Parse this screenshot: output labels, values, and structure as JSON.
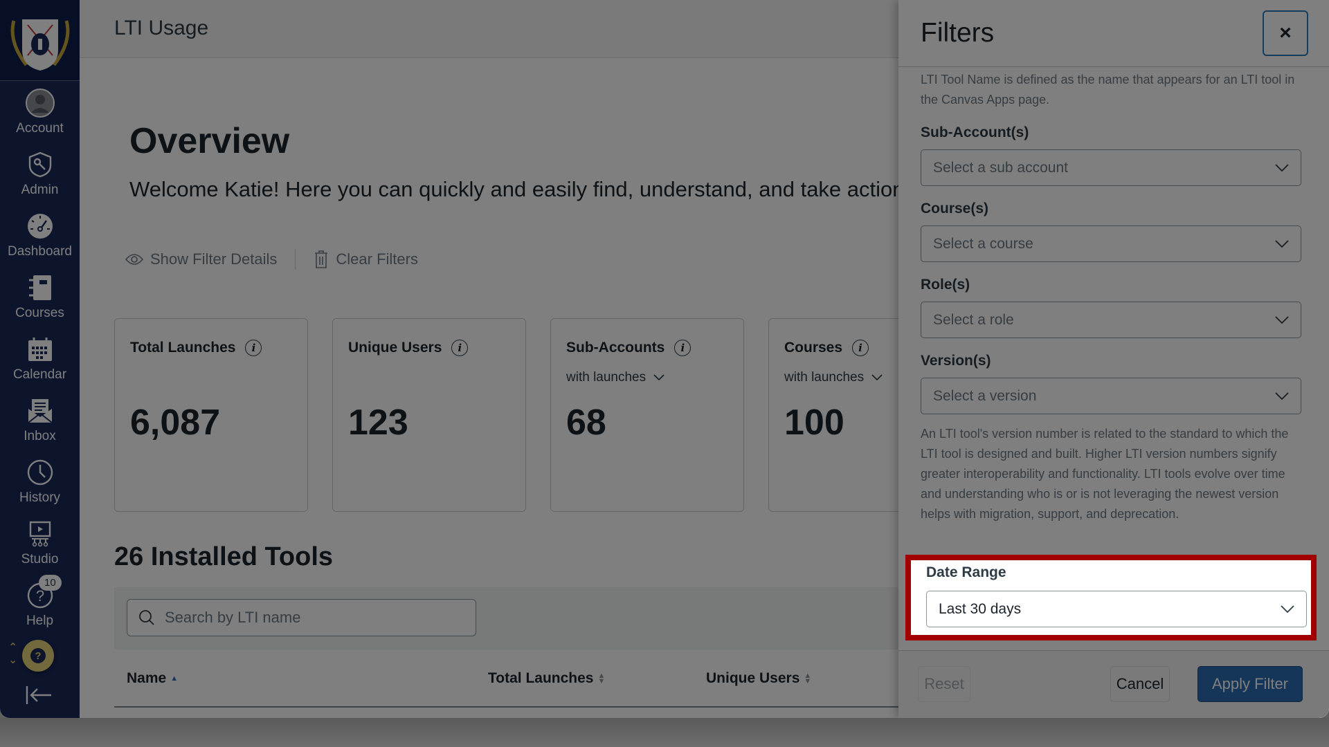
{
  "nav": {
    "items": [
      {
        "label": "Account",
        "icon": "account-avatar-icon"
      },
      {
        "label": "Admin",
        "icon": "admin-shield-key-icon"
      },
      {
        "label": "Dashboard",
        "icon": "dashboard-gauge-icon"
      },
      {
        "label": "Courses",
        "icon": "courses-notebook-icon"
      },
      {
        "label": "Calendar",
        "icon": "calendar-icon"
      },
      {
        "label": "Inbox",
        "icon": "inbox-envelope-icon"
      },
      {
        "label": "History",
        "icon": "history-clock-icon"
      },
      {
        "label": "Studio",
        "icon": "studio-screen-icon"
      },
      {
        "label": "Help",
        "icon": "help-question-icon"
      }
    ],
    "help_badge": "10",
    "help_fab": "?"
  },
  "page": {
    "title": "LTI Usage",
    "heading": "Overview",
    "welcome": "Welcome Katie! Here you can quickly and easily find, understand, and take action on",
    "show_filter_details": "Show Filter Details",
    "clear_filters": "Clear Filters"
  },
  "cards": [
    {
      "title": "Total Launches",
      "value": "6,087"
    },
    {
      "title": "Unique Users",
      "value": "123"
    },
    {
      "title": "Sub-Accounts",
      "subtitle": "with launches",
      "value": "68"
    },
    {
      "title": "Courses",
      "subtitle": "with launches",
      "value": "100"
    }
  ],
  "tools": {
    "heading": "26 Installed Tools",
    "search_placeholder": "Search by LTI name",
    "columns": [
      "Name",
      "Total Launches",
      "Unique Users"
    ]
  },
  "filters": {
    "title": "Filters",
    "close": "×",
    "tool_name_help": "LTI Tool Name is defined as the name that appears for an LTI tool in the Canvas Apps page.",
    "fields": [
      {
        "label": "Sub-Account(s)",
        "placeholder": "Select a sub account"
      },
      {
        "label": "Course(s)",
        "placeholder": "Select a course"
      },
      {
        "label": "Role(s)",
        "placeholder": "Select a role"
      },
      {
        "label": "Version(s)",
        "placeholder": "Select a version"
      }
    ],
    "version_help": "An LTI tool's version number is related to the standard to which the LTI tool is designed and built. Higher LTI version numbers signify greater interoperability and functionality. LTI tools evolve over time and understanding who is or is not leveraging the newest version helps with migration, support, and deprecation.",
    "date_range": {
      "label": "Date Range",
      "value": "Last 30 days"
    },
    "reset": "Reset",
    "cancel": "Cancel",
    "apply": "Apply Filter"
  },
  "colors": {
    "nav_bg": "#1a2a5a",
    "highlight": "#a00000",
    "primary": "#2b6cb0",
    "help_fab": "#e5d27a"
  }
}
